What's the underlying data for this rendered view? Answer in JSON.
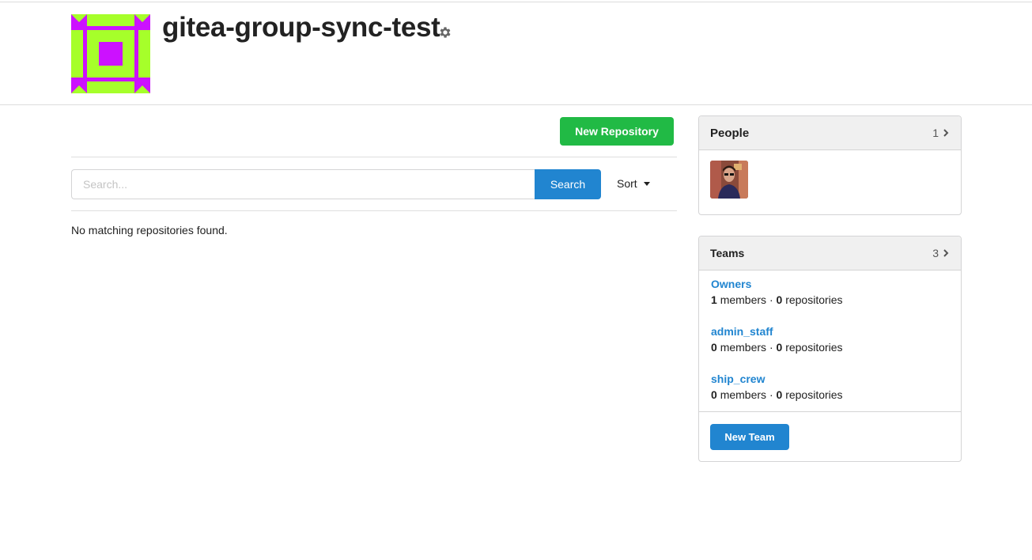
{
  "org": {
    "name": "gitea-group-sync-test",
    "avatar_icon": "identicon-avatar",
    "settings_icon": "gear-icon"
  },
  "repos": {
    "new_repo_label": "New Repository",
    "search_placeholder": "Search...",
    "search_label": "Search",
    "sort_label": "Sort",
    "empty_text": "No matching repositories found."
  },
  "people": {
    "title": "People",
    "count": "1"
  },
  "teams": {
    "title": "Teams",
    "count": "3",
    "items": [
      {
        "name": "Owners",
        "members": "1",
        "members_label": "members",
        "sep": "·",
        "repos": "0",
        "repos_label": "repositories"
      },
      {
        "name": "admin_staff",
        "members": "0",
        "members_label": "members",
        "sep": "·",
        "repos": "0",
        "repos_label": "repositories"
      },
      {
        "name": "ship_crew",
        "members": "0",
        "members_label": "members",
        "sep": "·",
        "repos": "0",
        "repos_label": "repositories"
      }
    ],
    "new_team_label": "New Team"
  },
  "colors": {
    "identicon_fg": "#a6ff2a",
    "identicon_bg": "#cc11ff",
    "primary": "#2185d0",
    "success": "#21ba45"
  }
}
